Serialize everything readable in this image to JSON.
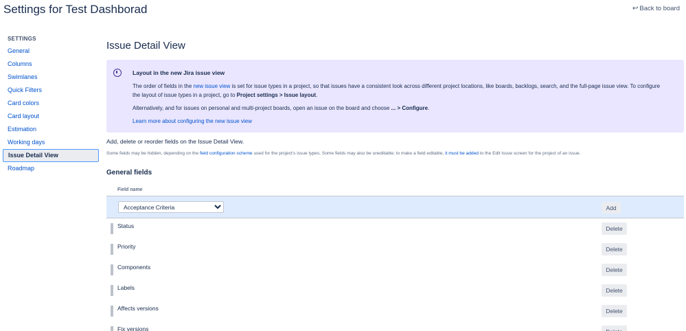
{
  "header": {
    "title": "Settings for Test Dashborad",
    "back_label": "Back to board"
  },
  "sidebar": {
    "heading": "SETTINGS",
    "items": [
      {
        "label": "General"
      },
      {
        "label": "Columns"
      },
      {
        "label": "Swimlanes"
      },
      {
        "label": "Quick Filters"
      },
      {
        "label": "Card colors"
      },
      {
        "label": "Card layout"
      },
      {
        "label": "Estimation"
      },
      {
        "label": "Working days"
      },
      {
        "label": "Issue Detail View",
        "active": true
      },
      {
        "label": "Roadmap"
      }
    ]
  },
  "main": {
    "title": "Issue Detail View",
    "info": {
      "title": "Layout in the new Jira issue view",
      "p1_a": "The order of fields in the ",
      "p1_link": "new issue view",
      "p1_b": " is set for issue types in a project, so that issues have a consistent look across different project locations, like boards, backlogs, search, and the full-page issue view. To configure the layout of issue types in a project, go to ",
      "p1_bold": "Project settings > Issue layout",
      "p1_end": ".",
      "p2_a": "Alternatively, and for issues on personal and multi-project boards, open an issue on the board and choose ",
      "p2_bold": "... > Configure",
      "p2_end": ".",
      "learn_more": "Learn more about configuring the new issue view"
    },
    "intro": "Add, delete or reorder fields on the Issue Detail View.",
    "note": {
      "a": "Some fields may be hidden, depending on the ",
      "link1": "field configuration scheme",
      "b": " used for the project's issue types. Some fields may also be uneditable; to make a field editable, ",
      "link2": "it must be added",
      "c": " to the Edit Issue screen for the project of an issue."
    },
    "subheading": "General fields",
    "table": {
      "column_header": "Field name",
      "select_value": "Acceptance Criteria",
      "add_label": "Add",
      "delete_label": "Delete",
      "rows": [
        {
          "name": "Status"
        },
        {
          "name": "Priority"
        },
        {
          "name": "Components"
        },
        {
          "name": "Labels"
        },
        {
          "name": "Affects versions"
        },
        {
          "name": "Fix versions"
        }
      ]
    }
  },
  "colors": {
    "link": "#0052cc",
    "info_background": "#eae6ff",
    "add_row_background": "#deebff"
  }
}
